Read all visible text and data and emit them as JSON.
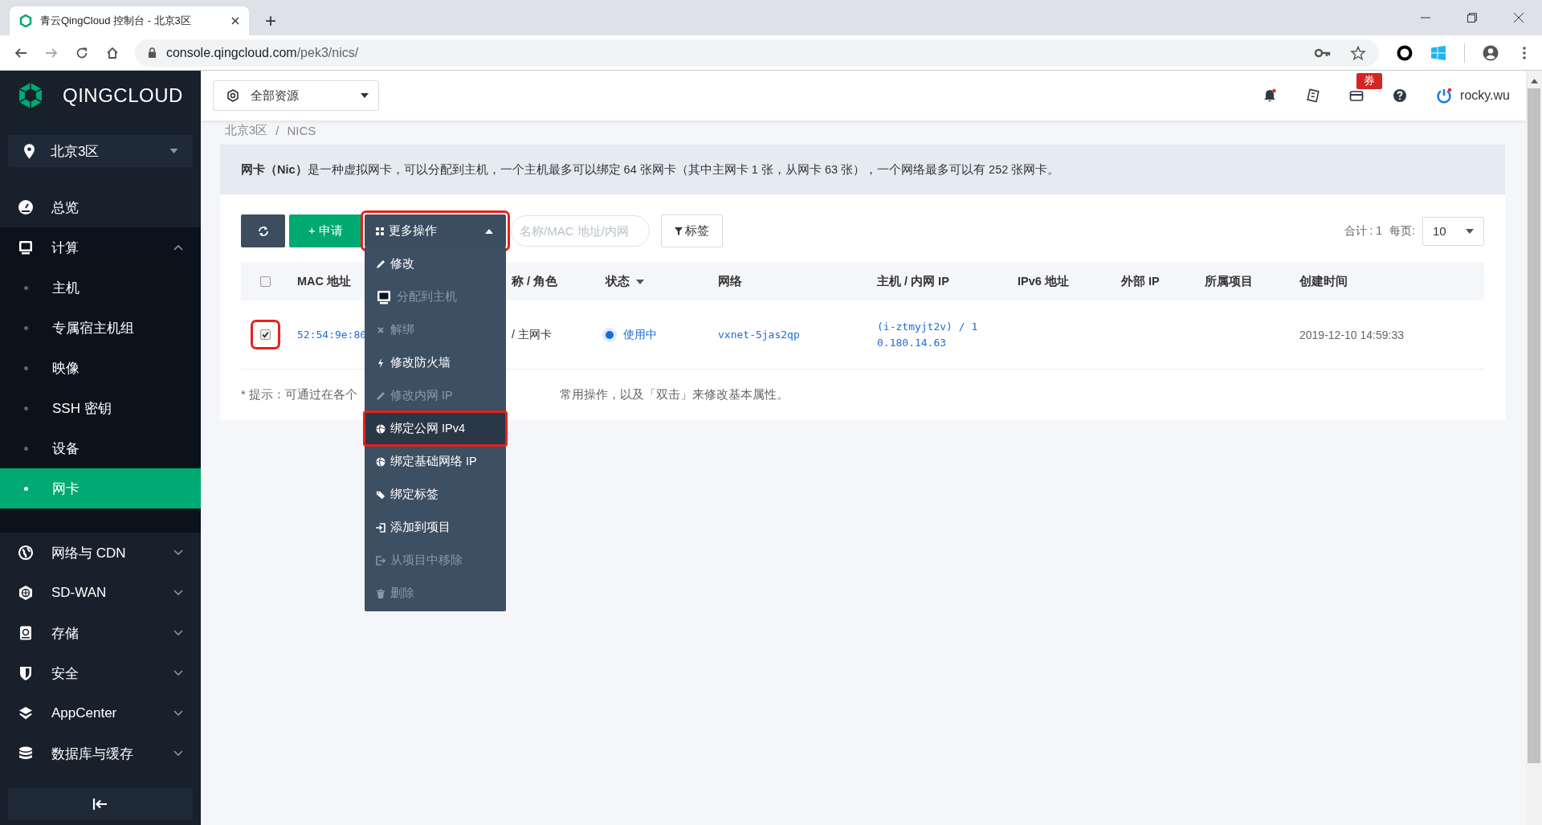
{
  "browser": {
    "tab_title": "青云QingCloud 控制台 - 北京3区",
    "new_tab": "+",
    "url_host": "console.qingcloud.com",
    "url_path": "/pek3/nics/"
  },
  "header": {
    "logo": "QINGCLOUD",
    "resource_selector": "全部资源",
    "bell_dot": true,
    "coupon_badge": "券",
    "user_dot": true,
    "user": "rocky.wu"
  },
  "sidebar": {
    "region": "北京3区",
    "items": [
      {
        "label": "总览"
      },
      {
        "label": "计算",
        "expanded": true,
        "children": [
          {
            "label": "主机",
            "selected": false
          },
          {
            "label": "专属宿主机组",
            "selected": false
          },
          {
            "label": "映像",
            "selected": false
          },
          {
            "label": "SSH 密钥",
            "selected": false
          },
          {
            "label": "设备",
            "selected": false
          },
          {
            "label": "网卡",
            "selected": true
          }
        ]
      },
      {
        "label": "网络与 CDN",
        "expanded": false
      },
      {
        "label": "SD-WAN",
        "expanded": false
      },
      {
        "label": "存储",
        "expanded": false
      },
      {
        "label": "安全",
        "expanded": false
      },
      {
        "label": "AppCenter",
        "expanded": false
      },
      {
        "label": "数据库与缓存",
        "expanded": false
      }
    ]
  },
  "breadcrumb": {
    "items": [
      "北京3区",
      "NICS"
    ],
    "separator": "/"
  },
  "info": "**网卡（Nic）**是一种虚拟网卡，可以分配到主机，一个主机最多可以绑定 64 张网卡（其中主网卡 1 张，从网卡 63 张），一个网络最多可以有 252 张网卡。",
  "toolbar": {
    "apply": "+ 申请",
    "more": {
      "label": "更多操作",
      "expanded": true,
      "annotated": true
    },
    "search": {
      "placeholder": "名称/MAC 地址/内网"
    },
    "tag_filter": "标签",
    "total": "合计 : 1",
    "per_page_label": "每页:",
    "per_page": "10"
  },
  "menu": [
    {
      "label": "修改",
      "disabled": false,
      "annotated": false
    },
    {
      "label": "分配到主机",
      "disabled": true,
      "annotated": false
    },
    {
      "label": "解绑",
      "disabled": true,
      "annotated": false
    },
    {
      "label": "修改防火墙",
      "disabled": false,
      "annotated": false
    },
    {
      "label": "修改内网 IP",
      "disabled": true,
      "annotated": false
    },
    {
      "label": "绑定公网 IPv4",
      "disabled": false,
      "annotated": true
    },
    {
      "label": "绑定基础网络 IP",
      "disabled": false,
      "annotated": false
    },
    {
      "label": "绑定标签",
      "disabled": false,
      "annotated": false
    },
    {
      "label": "添加到项目",
      "disabled": false,
      "annotated": false
    },
    {
      "label": "从项目中移除",
      "disabled": true,
      "annotated": false
    },
    {
      "label": "删除",
      "disabled": true,
      "annotated": false
    }
  ],
  "table": {
    "select_all": {
      "checked": false
    },
    "columns": [
      {
        "label": "MAC 地址"
      },
      {
        "label": "称 / 角色"
      },
      {
        "label": "状态",
        "sortable": true
      },
      {
        "label": "网络"
      },
      {
        "label": "主机 / 内网 IP"
      },
      {
        "label": "IPv6 地址"
      },
      {
        "label": "外部 IP"
      },
      {
        "label": "所属项目"
      },
      {
        "label": "创建时间"
      }
    ],
    "rows": [
      {
        "selected": true,
        "annotated": true,
        "mac": "52:54:9e:80",
        "name_role": "/ 主网卡",
        "status": {
          "label": "使用中",
          "color": "#1769e0"
        },
        "network": "vxnet-5jas2qp",
        "host_ip": "(i-ztmyjt2v) / 10.180.14.63",
        "created": "2019-12-10 14:59:33"
      }
    ]
  },
  "hint": [
    "* 提示：可通过在各个",
    "常用操作，以及「双击」来修改基本属性。"
  ]
}
